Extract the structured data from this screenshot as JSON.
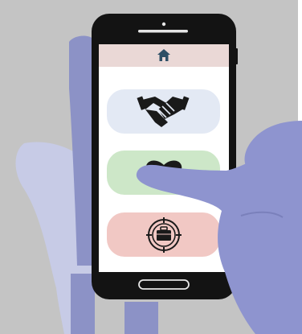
{
  "illustration": {
    "background_color": "#c4c4c4",
    "left_hand_color": "#c7cbe6",
    "left_arm_color": "#8c92c6",
    "right_hand_color": "#8e94cf",
    "phone_body_color": "#131313",
    "screen_color": "#ffffff",
    "screen_header_color": "#ead8d6",
    "cards": [
      {
        "icon": "handshake-icon",
        "color": "#e3e9f4"
      },
      {
        "icon": "heart-icon",
        "color": "#cde7c8"
      },
      {
        "icon": "briefcase-target-icon",
        "color": "#f1c8c4"
      }
    ],
    "header_icon": "home-icon"
  }
}
